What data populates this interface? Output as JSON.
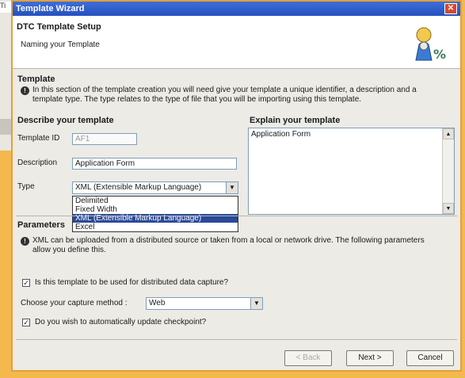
{
  "background": {
    "tab_label": "Ti"
  },
  "dialog": {
    "title": "Template Wizard",
    "close_glyph": "✕",
    "header": {
      "title": "DTC Template Setup",
      "subtitle": "Naming your Template"
    },
    "template_section": {
      "title": "Template",
      "info": "In this section of the template creation you will need give your template a unique identifier, a description and a template type. The type relates to the type of file that you will be importing using this template."
    },
    "describe": {
      "title": "Describe your template",
      "template_id_label": "Template ID",
      "template_id_value": "AF1",
      "description_label": "Description",
      "description_value": "Application Form",
      "type_label": "Type",
      "type_value": "XML (Extensible Markup Language)",
      "type_options": [
        "Delimited",
        "Fixed Width",
        "XML (Extensible Markup Language)",
        "Excel"
      ],
      "type_selected_index": 2
    },
    "explain": {
      "title": "Explain your template",
      "value": "Application Form"
    },
    "parameters": {
      "title": "Parameters",
      "info": "XML can be uploaded from a distributed source or taken from a local or network drive. The following parameters allow you define this.",
      "distributed_label": "Is this template to be used for distributed data capture?",
      "distributed_checked": true,
      "capture_label": "Choose your capture method :",
      "capture_value": "Web",
      "checkpoint_label": "Do you wish to automatically update checkpoint?",
      "checkpoint_checked": true
    },
    "buttons": {
      "back": "< Back",
      "next": "Next >",
      "cancel": "Cancel"
    }
  }
}
